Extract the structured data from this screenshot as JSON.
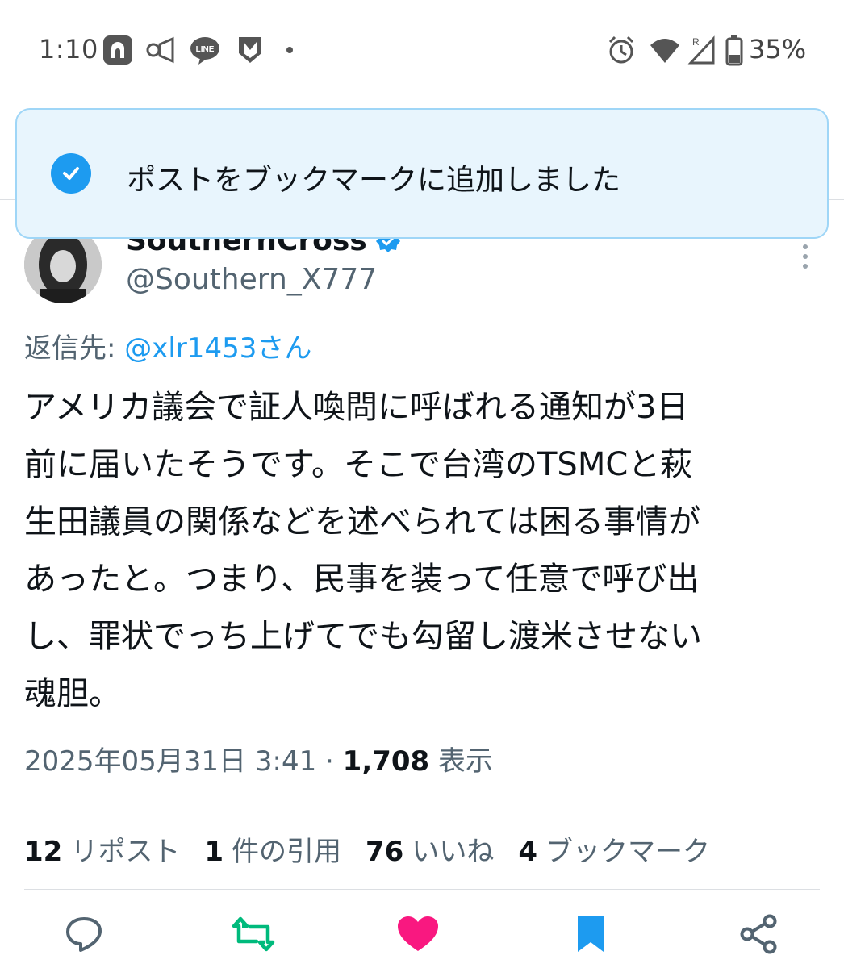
{
  "status_bar": {
    "time": "1:10",
    "battery": "35%",
    "left_icons": [
      "vpn-key-icon",
      "nfc-speaker-icon",
      "line-app-icon",
      "mcafee-shield-icon",
      "dot-icon"
    ],
    "right_icons": [
      "alarm-icon",
      "wifi-icon",
      "signal-roaming-icon",
      "battery-icon"
    ]
  },
  "toast": {
    "message": "ポストをブックマークに追加しました",
    "icon": "check-circle-icon",
    "color": "#1d9bf0"
  },
  "author": {
    "display_name": "SouthernCross",
    "handle": "@Southern_X777",
    "verified": true
  },
  "reply": {
    "prefix": "返信先: ",
    "mention": "@xlr1453さん"
  },
  "tweet": {
    "lines": [
      "アメリカ議会で証人喚問に呼ばれる通知が3日",
      "前に届いたそうです。そこで台湾のTSMCと萩",
      "生田議員の関係などを述べられては困る事情が",
      "あったと。つまり、民事を装って任意で呼び出",
      "し、罪状でっち上げてでも勾留し渡米させない",
      "魂胆。"
    ]
  },
  "meta": {
    "datetime": "2025年05月31日 3:41",
    "separator": " · ",
    "views": "1,708",
    "views_label": " 表示"
  },
  "stats": [
    {
      "count": "12",
      "label": "リポスト"
    },
    {
      "count": "1",
      "label": "件の引用"
    },
    {
      "count": "76",
      "label": "いいね"
    },
    {
      "count": "4",
      "label": "ブックマーク"
    }
  ],
  "actions": {
    "reply": "reply-icon",
    "repost": "repost-icon",
    "like": "like-icon",
    "bookmark": "bookmark-icon",
    "share": "share-icon",
    "colors": {
      "repost": "#00ba7c",
      "like": "#f91880",
      "bookmark": "#1d9bf0",
      "default": "#536471"
    }
  }
}
